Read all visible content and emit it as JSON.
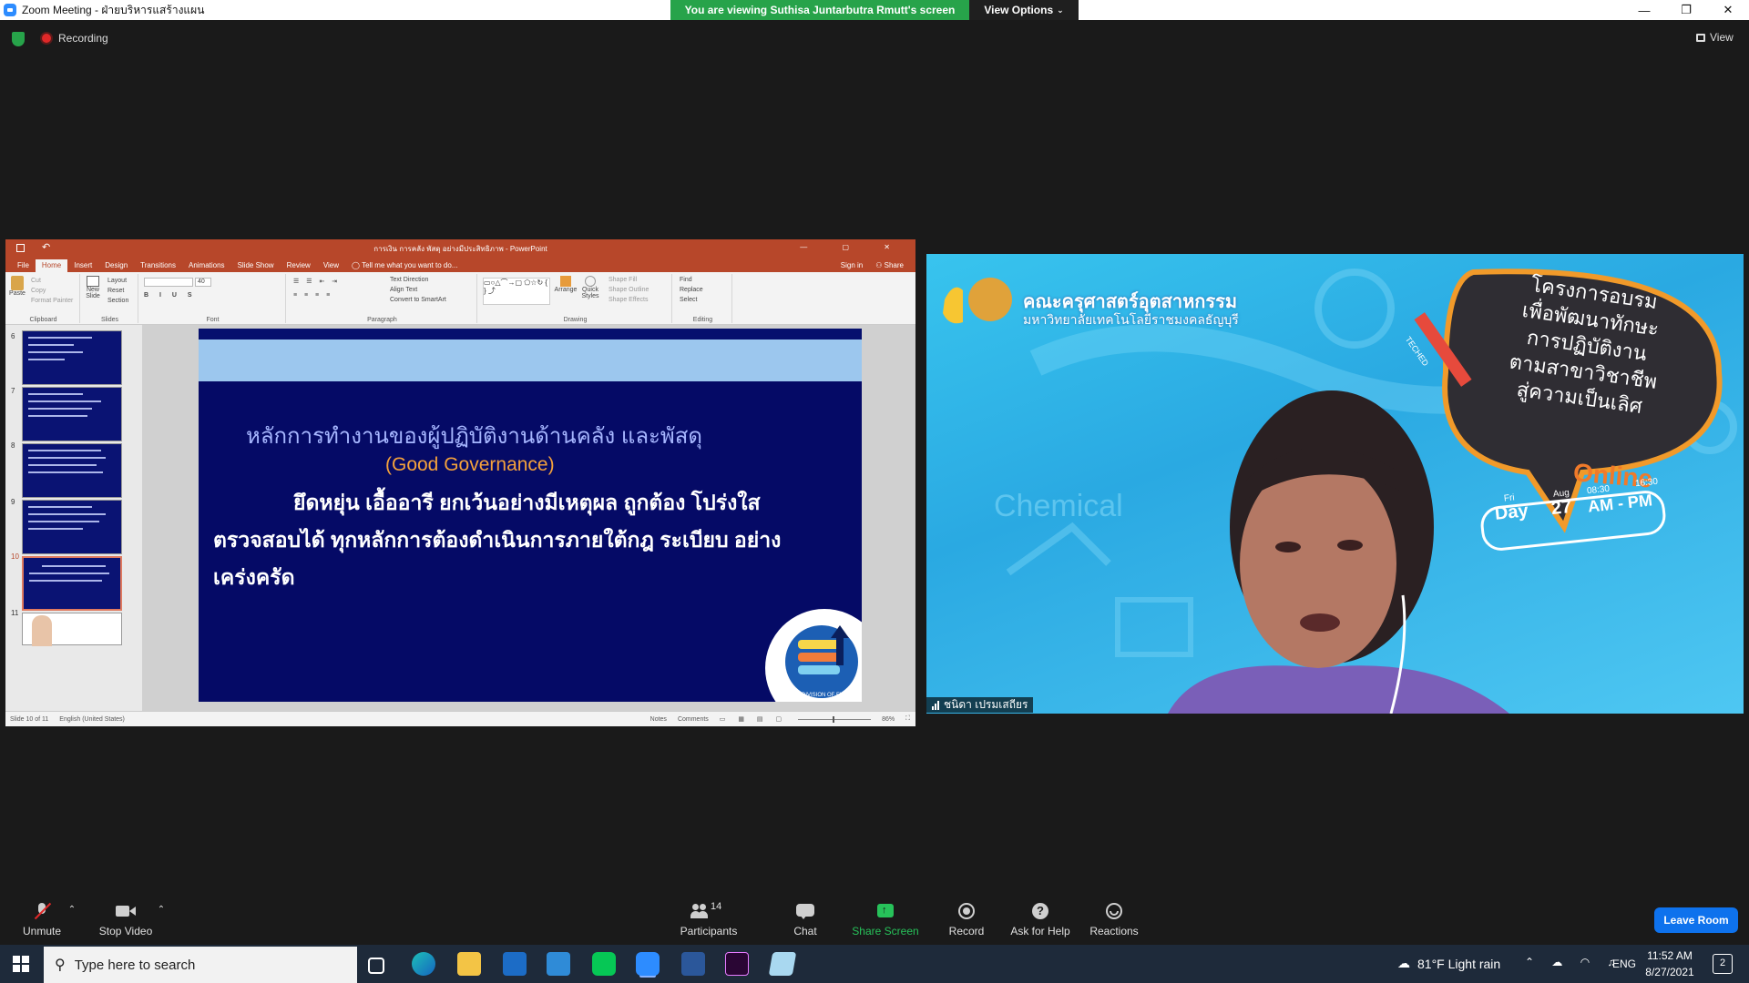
{
  "window": {
    "title": "Zoom Meeting - ฝ่ายบริหารแสร้างแผน",
    "viewing_banner": "You are viewing Suthisa  Juntarbutra Rmutt's screen",
    "view_options": "View Options",
    "view_label": "View"
  },
  "recording": {
    "label": "Recording"
  },
  "powerpoint": {
    "title": "การเงิน การคลัง พัสดุ อย่างมีประสิทธิภาพ - PowerPoint",
    "sign_in": "Sign in",
    "share": "Share",
    "tabs": [
      "File",
      "Home",
      "Insert",
      "Design",
      "Transitions",
      "Animations",
      "Slide Show",
      "Review",
      "View"
    ],
    "tell_me": "Tell me what you want to do...",
    "ribbon_groups": [
      "Clipboard",
      "Slides",
      "Font",
      "Paragraph",
      "Drawing",
      "Editing"
    ],
    "ribbon_items": {
      "paste": "Paste",
      "cut": "Cut",
      "copy": "Copy",
      "format_painter": "Format Painter",
      "new_slide": "New Slide",
      "layout": "Layout",
      "reset": "Reset",
      "section": "Section",
      "text_direction": "Text Direction",
      "align_text": "Align Text",
      "convert_smartart": "Convert to SmartArt",
      "arrange": "Arrange",
      "quick_styles": "Quick Styles",
      "shape_fill": "Shape Fill",
      "shape_outline": "Shape Outline",
      "shape_effects": "Shape Effects",
      "find": "Find",
      "replace": "Replace",
      "select": "Select",
      "font_size": "40"
    },
    "thumb_numbers": [
      "6",
      "7",
      "8",
      "9",
      "10",
      "11"
    ],
    "slide": {
      "title_line": "หลักการทำงานของผู้ปฏิบัติงานด้านคลัง และพัสดุ",
      "subtitle": "(Good Governance)",
      "body_line1": "ยึดหยุ่น เอื้ออารี ยกเว้นอย่างมีเหตุผล ถูกต้อง โปร่งใส",
      "body_line2": "ตรวจสอบได้ ทุกหลักการต้องดำเนินการภายใต้กฎ ระเบียบ อย่าง",
      "body_line3": "เคร่งครัด",
      "logo_text": "DIVISION OF FINANCE"
    },
    "status": {
      "slide_of": "Slide 10 of 11",
      "language": "English (United States)",
      "notes": "Notes",
      "comments": "Comments",
      "zoom": "86%"
    }
  },
  "video": {
    "faculty_line1": "คณะครุศาสตร์อุตสาหกรรม",
    "faculty_line2": "มหาวิทยาลัยเทคโนโลยีราชมงคลธัญบุรี",
    "bubble_lines": [
      "โครงการอบรม",
      "เพื่อพัฒนาทักษะ",
      "การปฏิบัติงาน",
      "ตามสาขาวิชาชีพ",
      "สู่ความเป็นเลิศ"
    ],
    "pencil_text": "TECHED",
    "online": "Online",
    "date_fri": "Fri",
    "date_day": "Day",
    "date_aug": "Aug",
    "date_27": "27",
    "time_start": "08:30",
    "time_end": "16:30",
    "am_pm": "AM - PM",
    "bg_word": "Chemical",
    "participant_name": "ชนิดา เปรมเสถียร"
  },
  "toolbar": {
    "unmute": "Unmute",
    "stop_video": "Stop Video",
    "participants": "Participants",
    "participants_count": "14",
    "chat": "Chat",
    "share_screen": "Share Screen",
    "record": "Record",
    "ask_help": "Ask for Help",
    "reactions": "Reactions",
    "leave": "Leave Room"
  },
  "taskbar": {
    "search_placeholder": "Type here to search",
    "weather": "81°F  Light rain",
    "lang": "ENG",
    "time": "11:52 AM",
    "date": "8/27/2021",
    "notif_count": "2"
  },
  "colors": {
    "ppt_red": "#b7472a",
    "slide_navy": "#050a66",
    "zoom_blue": "#0e72ed",
    "green": "#27a34a"
  }
}
